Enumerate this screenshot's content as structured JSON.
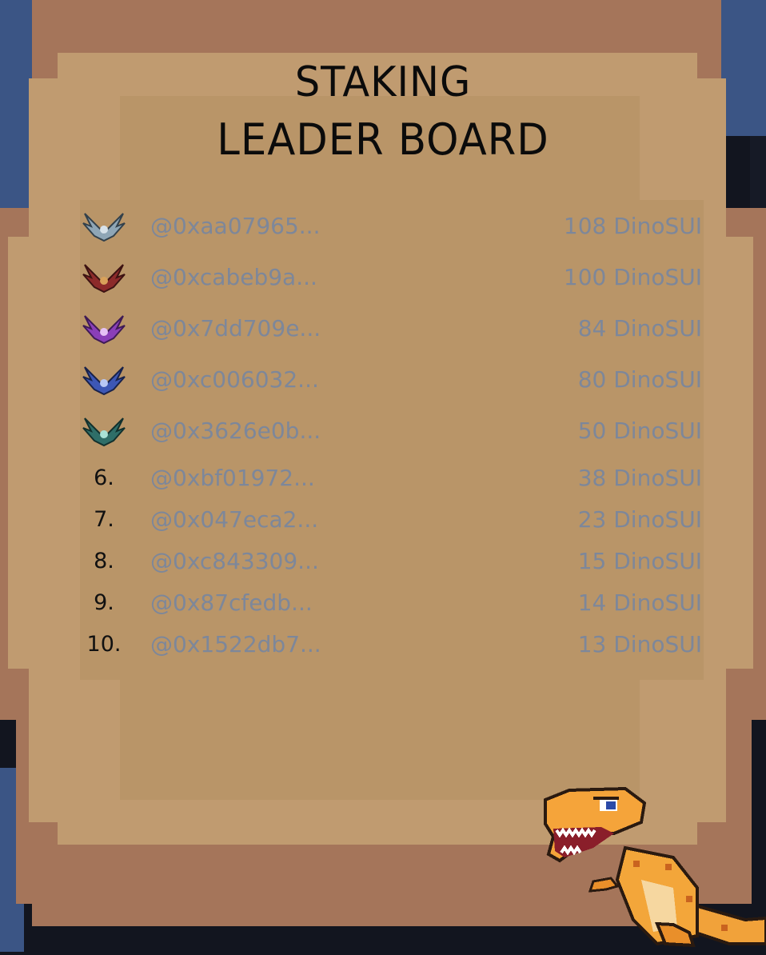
{
  "title": {
    "line1": "STAKING",
    "line2": "LEADER BOARD"
  },
  "leaderboard": [
    {
      "rank": "1",
      "badge": "silver-emblem-icon",
      "badge_color": "#8fa6b6",
      "address": "@0xaa07965...",
      "amount": "108 DinoSUI"
    },
    {
      "rank": "2",
      "badge": "red-emblem-icon",
      "badge_color": "#8c2a2a",
      "address": "@0xcabeb9a...",
      "amount": "100 DinoSUI"
    },
    {
      "rank": "3",
      "badge": "purple-emblem-icon",
      "badge_color": "#8a3fb8",
      "address": "@0x7dd709e...",
      "amount": "84 DinoSUI"
    },
    {
      "rank": "4",
      "badge": "blue-emblem-icon",
      "badge_color": "#3d57b5",
      "address": "@0xc006032...",
      "amount": "80 DinoSUI"
    },
    {
      "rank": "5",
      "badge": "green-emblem-icon",
      "badge_color": "#2f6e68",
      "address": "@0x3626e0b...",
      "amount": "50 DinoSUI"
    },
    {
      "rank": "6.",
      "address": "@0xbf01972...",
      "amount": "38 DinoSUI"
    },
    {
      "rank": "7.",
      "address": "@0x047eca2...",
      "amount": "23 DinoSUI"
    },
    {
      "rank": "8.",
      "address": "@0xc843309...",
      "amount": "15 DinoSUI"
    },
    {
      "rank": "9.",
      "address": "@0x87cfedb...",
      "amount": "14 DinoSUI"
    },
    {
      "rank": "10.",
      "address": "@0x1522db7...",
      "amount": "13 DinoSUI"
    }
  ],
  "mascot": "dinosaur-icon"
}
